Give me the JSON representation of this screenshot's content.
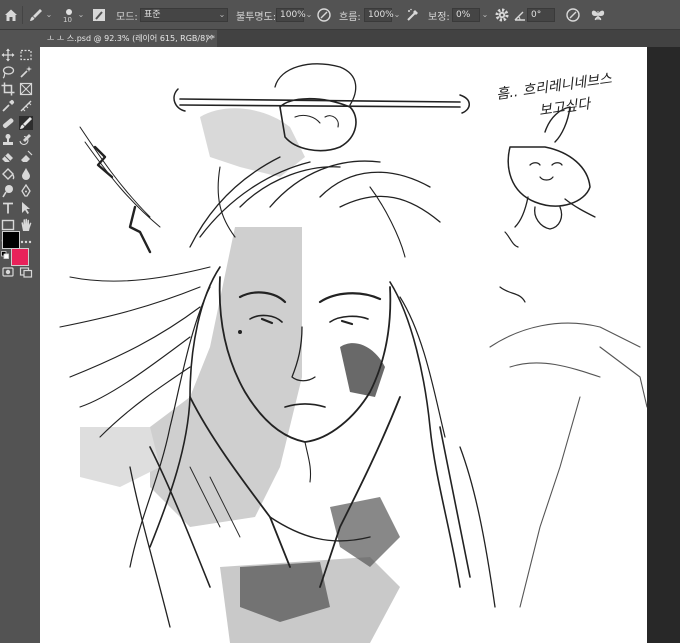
{
  "options_bar": {
    "brush_size": "10",
    "mode_label": "모드:",
    "mode_value": "표준",
    "opacity_label": "불투명도:",
    "opacity_value": "100%",
    "flow_label": "흐름:",
    "flow_value": "100%",
    "smoothing_label": "보정:",
    "smoothing_value": "0%",
    "angle_value": "0°"
  },
  "document_tab": {
    "title": "ㅗ ㅗ 스.psd @ 92.3% (레이어 615, RGB/8) *",
    "close_glyph": "×"
  },
  "colors": {
    "foreground": "#000000",
    "background": "#e8225a",
    "toolbar_bg": "#535353",
    "app_bg": "#282828"
  },
  "artwork": {
    "handwritten_note": "흠.. 흐리레니네브스 보고싶다"
  }
}
